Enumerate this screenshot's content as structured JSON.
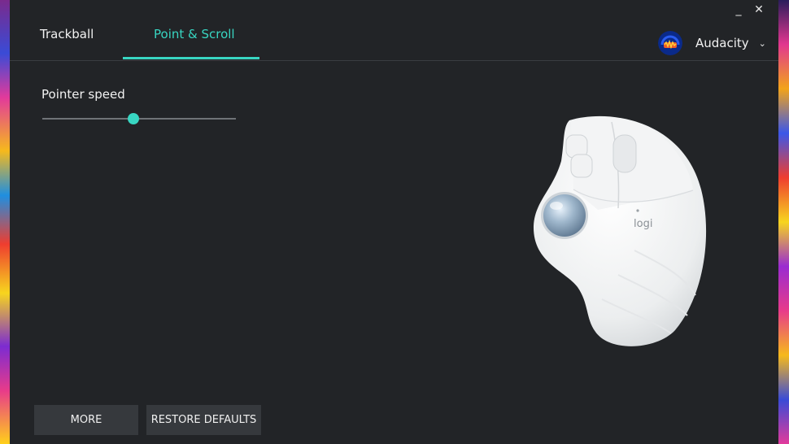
{
  "window": {
    "minimize_label": "_",
    "close_label": "✕"
  },
  "tabs": [
    {
      "label": "Trackball",
      "active": false
    },
    {
      "label": "Point & Scroll",
      "active": true
    }
  ],
  "app_selector": {
    "name": "Audacity",
    "icon": "audacity-icon",
    "chevron": "⌄"
  },
  "pointer": {
    "label": "Pointer speed",
    "speed_fraction": 0.47
  },
  "buttons": {
    "more": "MORE",
    "restore": "RESTORE DEFAULTS"
  },
  "device": {
    "logo_text": "logi",
    "image": "ergo-trackball-mouse"
  },
  "colors": {
    "accent": "#38d6c2",
    "background": "#222427",
    "button_bg": "#36393d"
  }
}
